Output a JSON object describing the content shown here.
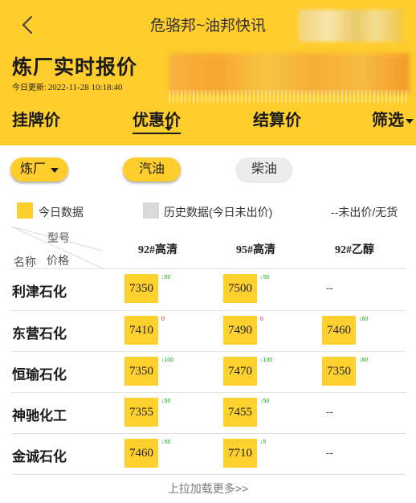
{
  "nav": {
    "title": "危骆邦~油邦快讯"
  },
  "header": {
    "title": "炼厂实时报价",
    "update_label": "今日更新:",
    "update_time": "2022-11-28 10:18:40"
  },
  "tabs": [
    {
      "label": "挂牌价",
      "active": false
    },
    {
      "label": "优惠价",
      "active": true
    },
    {
      "label": "结算价",
      "active": false
    },
    {
      "label": "筛选",
      "active": false
    }
  ],
  "filters": {
    "refinery": "炼厂",
    "gasoline": "汽油",
    "diesel": "柴油"
  },
  "legend": {
    "today": "今日数据",
    "history": "历史数据(今日未出价)",
    "none": "--未出价/无货"
  },
  "table": {
    "header_model": "型号",
    "header_name": "名称",
    "header_price": "价格",
    "columns": [
      "92#高清",
      "95#高清",
      "92#乙醇"
    ],
    "rows": [
      {
        "name": "利津石化",
        "cells": [
          {
            "price": "7350",
            "change": "↓50",
            "dir": "down"
          },
          {
            "price": "7500",
            "change": "↓50",
            "dir": "down"
          },
          {
            "price": "--"
          }
        ]
      },
      {
        "name": "东营石化",
        "cells": [
          {
            "price": "7410",
            "change": "0",
            "dir": "flat"
          },
          {
            "price": "7490",
            "change": "0",
            "dir": "flat"
          },
          {
            "price": "7460",
            "change": "↓60",
            "dir": "down"
          }
        ]
      },
      {
        "name": "恒瑜石化",
        "cells": [
          {
            "price": "7350",
            "change": "↓100",
            "dir": "down"
          },
          {
            "price": "7470",
            "change": "↓100",
            "dir": "down"
          },
          {
            "price": "7350",
            "change": "↓60",
            "dir": "down"
          }
        ]
      },
      {
        "name": "神驰化工",
        "cells": [
          {
            "price": "7355",
            "change": "↓50",
            "dir": "down"
          },
          {
            "price": "7455",
            "change": "↓50",
            "dir": "down"
          },
          {
            "price": "--"
          }
        ]
      },
      {
        "name": "金诚石化",
        "cells": [
          {
            "price": "7460",
            "change": "↓50",
            "dir": "down"
          },
          {
            "price": "7710",
            "change": "↓5",
            "dir": "down"
          },
          {
            "price": "--"
          }
        ]
      }
    ]
  },
  "load_more": "上拉加载更多>>",
  "colors": {
    "accent": "#FFCD2C",
    "cell": "#FFD12E",
    "history": "#d9d9d9",
    "down": "#19a31b",
    "up": "#e52020"
  }
}
